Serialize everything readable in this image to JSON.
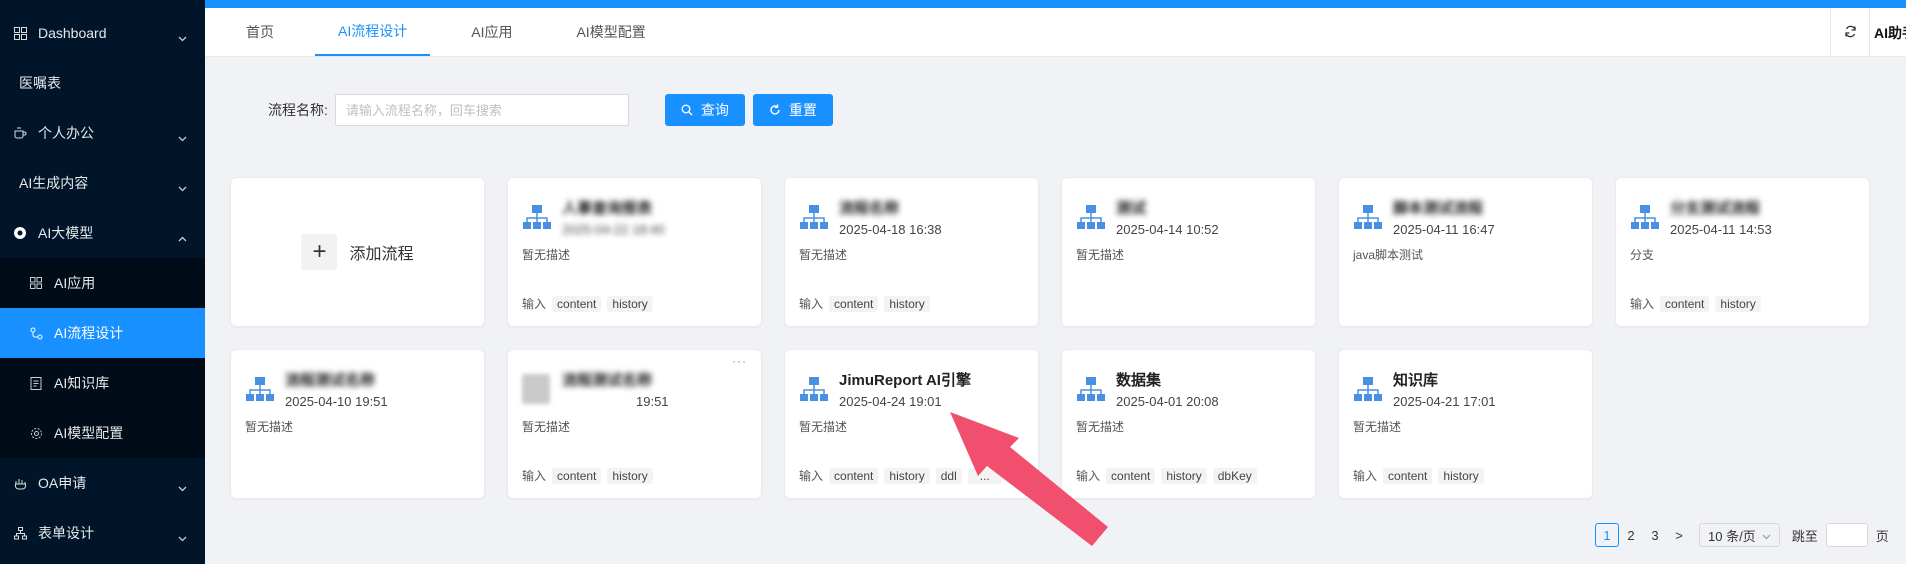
{
  "sidebar": {
    "items": [
      {
        "label": "Dashboard",
        "icon": "grid-icon",
        "chevron": "down"
      },
      {
        "label": "医嘱表"
      },
      {
        "label": "个人办公",
        "icon": "coffee-icon",
        "chevron": "down"
      },
      {
        "label": "AI生成内容",
        "chevron": "down"
      },
      {
        "label": "AI大模型",
        "icon": "openai-icon",
        "chevron": "up"
      },
      {
        "label": "AI应用",
        "icon": "grid-icon"
      },
      {
        "label": "AI流程设计",
        "icon": "flow-icon"
      },
      {
        "label": "AI知识库",
        "icon": "file-icon"
      },
      {
        "label": "AI模型配置",
        "icon": "gear-icon"
      },
      {
        "label": "OA申请",
        "icon": "hand-icon",
        "chevron": "down"
      },
      {
        "label": "表单设计",
        "icon": "tree-icon",
        "chevron": "down"
      }
    ]
  },
  "tabs": [
    {
      "label": "首页"
    },
    {
      "label": "AI流程设计"
    },
    {
      "label": "AI应用"
    },
    {
      "label": "AI模型配置"
    }
  ],
  "header": {
    "ai_helper": "AI助手"
  },
  "search": {
    "label": "流程名称:",
    "placeholder": "请输入流程名称，回车搜索",
    "query_label": "查询",
    "reset_label": "重置"
  },
  "add_card": {
    "label": "添加流程"
  },
  "cards": [
    {
      "name": "人事查询报表",
      "date": "2025-04-22 18:40",
      "desc": "暂无描述",
      "input_label": "输入",
      "tags": [
        "content",
        "history"
      ],
      "blurred": true
    },
    {
      "name": "流程名称",
      "date": "2025-04-18 16:38",
      "desc": "暂无描述",
      "input_label": "输入",
      "tags": [
        "content",
        "history"
      ],
      "blurred": true
    },
    {
      "name": "测试",
      "date": "2025-04-14 10:52",
      "desc": "暂无描述",
      "input_label": "",
      "tags": [],
      "blurred": true
    },
    {
      "name": "脚本测试流程",
      "date": "2025-04-11 16:47",
      "desc": "java脚本测试",
      "input_label": "",
      "tags": [],
      "blurred": true
    },
    {
      "name": "分支测试流程",
      "date": "2025-04-11 14:53",
      "desc": "分支",
      "input_label": "输入",
      "tags": [
        "content",
        "history"
      ],
      "blurred": true
    },
    {
      "name": "流程测试名称",
      "date": "2025-04-10 19:51",
      "desc": "暂无描述",
      "input_label": "",
      "tags": [],
      "blurred": true
    },
    {
      "name": "流程测试名称",
      "date": "19:51",
      "desc": "暂无描述",
      "input_label": "输入",
      "tags": [
        "content",
        "history"
      ],
      "blurred": true,
      "more": "···"
    },
    {
      "name": "JimuReport AI引擎",
      "date": "2025-04-24 19:01",
      "desc": "暂无描述",
      "input_label": "输入",
      "tags": [
        "content",
        "history",
        "ddl",
        "..."
      ],
      "blurred": false
    },
    {
      "name": "数据集",
      "date": "2025-04-01 20:08",
      "desc": "暂无描述",
      "input_label": "输入",
      "tags": [
        "content",
        "history",
        "dbKey"
      ],
      "blurred": false
    },
    {
      "name": "知识库",
      "date": "2025-04-21 17:01",
      "desc": "暂无描述",
      "input_label": "输入",
      "tags": [
        "content",
        "history"
      ],
      "blurred": false
    }
  ],
  "pagination": {
    "pages": [
      "1",
      "2",
      "3"
    ],
    "current": "1",
    "next": ">",
    "page_size": "10 条/页",
    "jump_label": "跳至",
    "page_suffix": "页"
  },
  "colors": {
    "sidebar_bg": "#001529",
    "accent": "#1890ff",
    "arrow": "#f0506e"
  }
}
